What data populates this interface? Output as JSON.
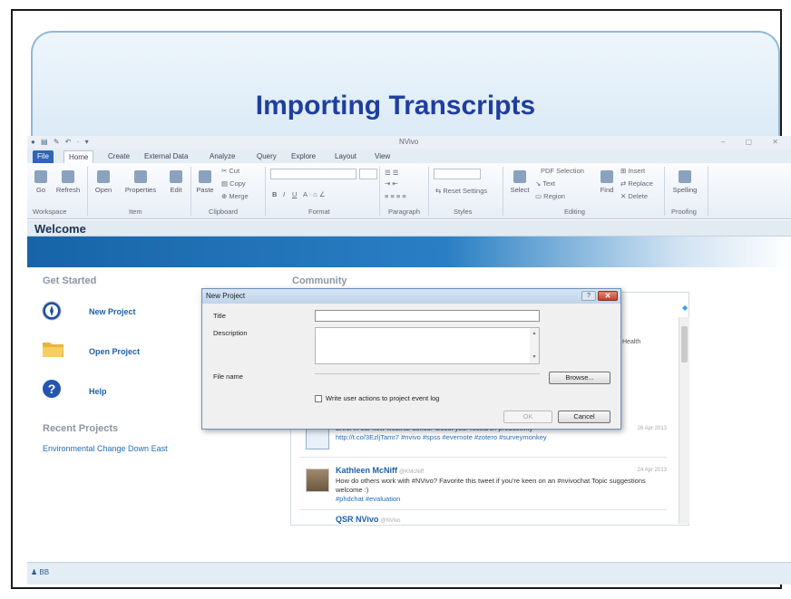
{
  "slide": {
    "title": "Importing Transcripts"
  },
  "window": {
    "title": "NVivo"
  },
  "tabs": [
    "File",
    "Home",
    "Create",
    "External Data",
    "Analyze",
    "Query",
    "Explore",
    "Layout",
    "View"
  ],
  "ribbon": {
    "workspace": {
      "go": "Go",
      "refresh": "Refresh",
      "group": "Workspace"
    },
    "item": {
      "open": "Open",
      "properties": "Properties",
      "edit": "Edit",
      "group": "Item"
    },
    "clipboard": {
      "paste": "Paste",
      "cut": "Cut",
      "copy": "Copy",
      "merge": "Merge",
      "group": "Clipboard"
    },
    "format": {
      "bold": "B",
      "italic": "I",
      "underline": "U",
      "group": "Format"
    },
    "paragraph": {
      "group": "Paragraph"
    },
    "styles": {
      "reset": "Reset Settings",
      "group": "Styles"
    },
    "editing": {
      "select": "Select",
      "pdf_selection": "PDF Selection",
      "text": "Text",
      "region": "Region",
      "find": "Find",
      "insert": "Insert",
      "replace": "Replace",
      "delete": "Delete",
      "group": "Editing"
    },
    "proofing": {
      "spelling": "Spelling",
      "group": "Proofing"
    }
  },
  "welcome": {
    "title": "Welcome",
    "get_started": "Get Started",
    "new_project": "New Project",
    "open_project": "Open Project",
    "help": "Help",
    "recent_heading": "Recent Projects",
    "recent_project": "Environmental Change Down East"
  },
  "community": {
    "heading": "Community",
    "health_text": "Health",
    "posts": [
      {
        "text": "Enrol in our new webinar series: 'Boost your research productivity'",
        "tags": "http://t.co/3EzljTamr7 #nvivo #spss #evernote #zotero #surveymonkey",
        "date": "26 Apr 2013"
      },
      {
        "author": "Kathleen McNiff",
        "handle": "@KMcNiff",
        "text": "How do others work with #NVivo? Favorite this tweet if you're keen on an #nvivochat Topic suggestions welcome :)",
        "tags": "#phdchat #evaluation",
        "date": "24 Apr 2013"
      },
      {
        "author": "QSR NVivo",
        "handle": "@NVivo"
      }
    ],
    "icon": "twitter-bird-icon"
  },
  "dialog": {
    "title": "New Project",
    "title_label": "Title",
    "title_value": "",
    "description_label": "Description",
    "file_name_label": "File name",
    "browse": "Browse...",
    "checkbox_label": "Write user actions to project event log",
    "ok": "OK",
    "cancel": "Cancel"
  },
  "status": {
    "user": "BB"
  },
  "colors": {
    "accent": "#1f3e9e",
    "link": "#1c5fa8",
    "band": "#1764a8"
  }
}
